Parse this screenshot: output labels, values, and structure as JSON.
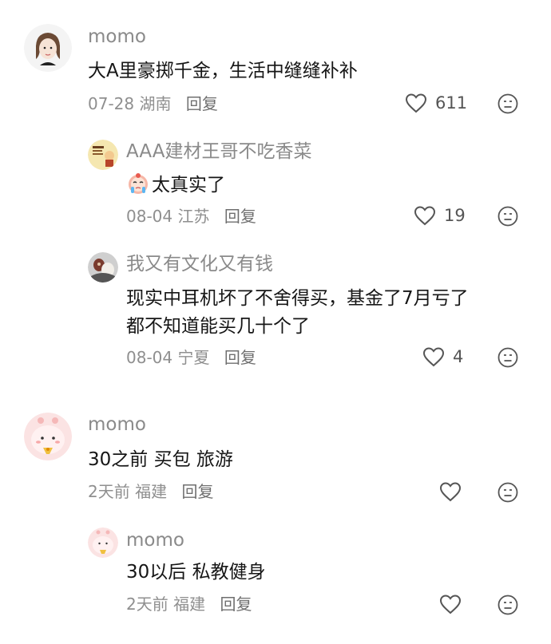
{
  "comments": [
    {
      "user": "momo",
      "text": [
        "大A里豪掷千金，生活中缝缝补补"
      ],
      "date": "07-28",
      "location": "湖南",
      "reply_label": "回复",
      "likes": "611",
      "avatar_icon": "girl-sketch-avatar-icon"
    },
    {
      "user": "AAA建材王哥不吃香菜",
      "text": [
        "太真实了"
      ],
      "text_emoji": "crying-face-emoji",
      "date": "08-04",
      "location": "江苏",
      "reply_label": "回复",
      "likes": "19",
      "avatar_icon": "coffee-sign-avatar-icon"
    },
    {
      "user": "我又有文化又有钱",
      "text": [
        "现实中耳机坏了不舍得买，基金了7月亏了",
        "都不知道能买几十个了"
      ],
      "date": "08-04",
      "location": "宁夏",
      "reply_label": "回复",
      "likes": "4",
      "avatar_icon": "photo-avatar-icon"
    },
    {
      "user": "momo",
      "text": [
        "30之前 买包 旅游"
      ],
      "date": "2天前",
      "location": "福建",
      "reply_label": "回复",
      "likes": "",
      "avatar_icon": "pink-blob-avatar-icon"
    },
    {
      "user": "momo",
      "text": [
        "30以后 私教健身"
      ],
      "date": "2天前",
      "location": "福建",
      "reply_label": "回复",
      "likes": "",
      "avatar_icon": "pink-blob-avatar-icon"
    }
  ],
  "colors": {
    "name": "#8a8a8a",
    "meta": "#8f8f8f",
    "text": "#161616",
    "icon": "#555555"
  }
}
